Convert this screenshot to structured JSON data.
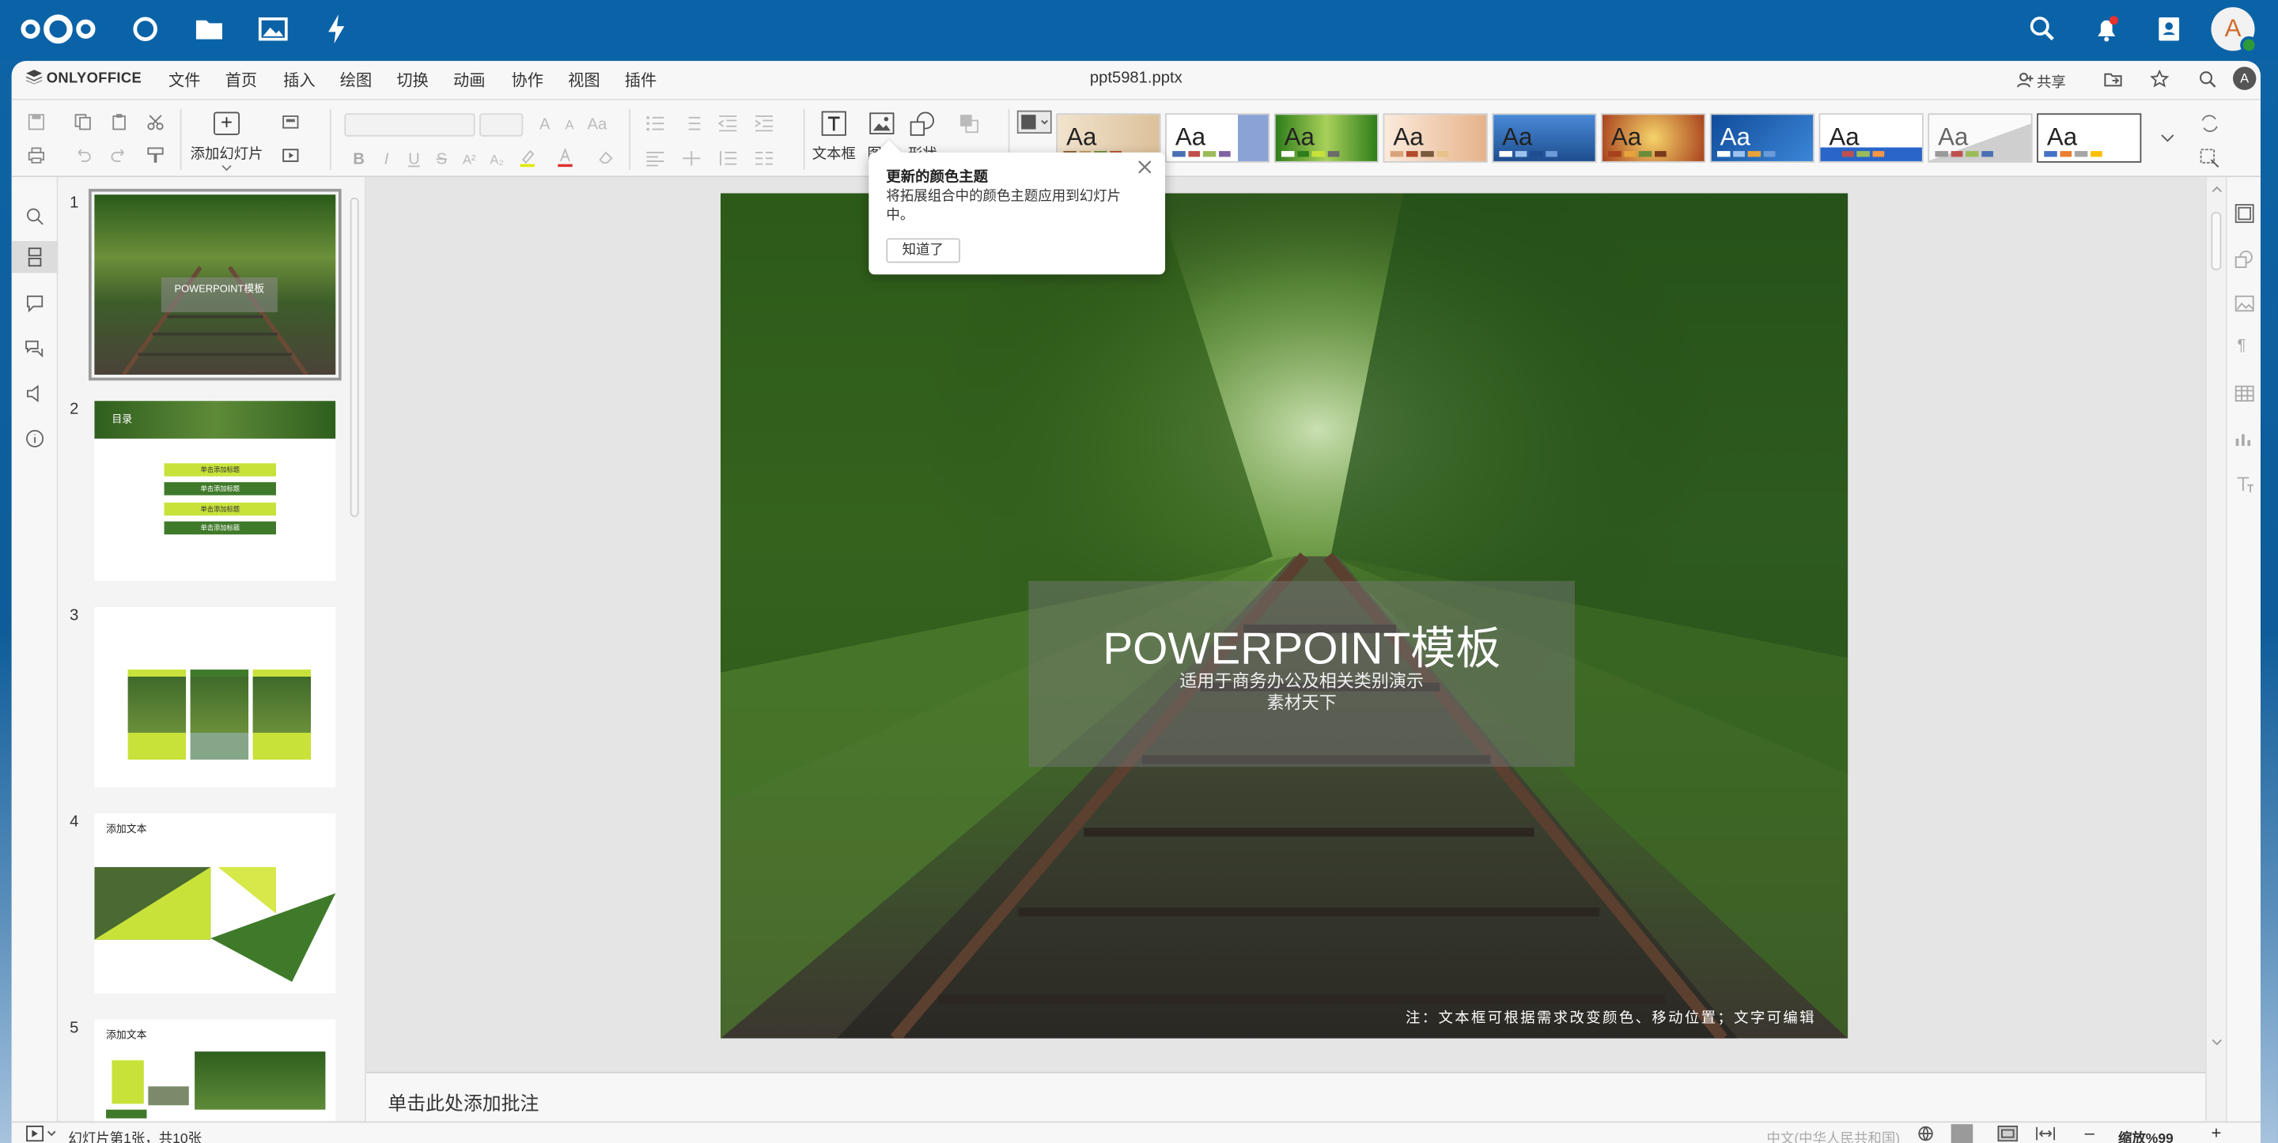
{
  "nextcloud": {
    "apps": [
      "dashboard-icon",
      "files-icon",
      "photos-icon",
      "activity-icon"
    ],
    "avatar_letter": "A"
  },
  "editor": {
    "brand": "ONLYOFFICE",
    "menu": [
      "文件",
      "首页",
      "插入",
      "绘图",
      "切换",
      "动画",
      "协作",
      "视图",
      "插件"
    ],
    "active_menu": "首页",
    "doc_title": "ppt5981.pptx",
    "share_label": "共享",
    "user_letter": "A"
  },
  "toolbar": {
    "add_slide": "添加幻灯片",
    "textbox": "文本框",
    "picture": "图片",
    "shape": "形状",
    "themes": [
      {
        "label": "Aa",
        "bg": "#e8d7bd",
        "accent": "#8a5a2b"
      },
      {
        "label": "Aa",
        "bg": "#dfe6f3",
        "accent": "#8aa2d6"
      },
      {
        "label": "Aa",
        "bg": "#9bc84a",
        "accent": "#2f7d1a"
      },
      {
        "label": "Aa",
        "bg": "#f6e2cf",
        "accent": "#d9a37a"
      },
      {
        "label": "Aa",
        "bg": "#3a77c6",
        "accent": "#1e4e8f"
      },
      {
        "label": "Aa",
        "bg": "#e8a23a",
        "accent": "#a8421d"
      },
      {
        "label": "Aa",
        "bg": "#2e6fc2",
        "accent": "#0f4c99"
      },
      {
        "label": "Aa",
        "bg": "#ffffff",
        "accent": "#2a66c9"
      },
      {
        "label": "Aa",
        "bg": "#eeeeee",
        "accent": "#9a9a9a"
      },
      {
        "label": "Aa",
        "bg": "#ffffff",
        "accent": "#cccccc"
      }
    ]
  },
  "popover": {
    "title": "更新的颜色主题",
    "body": "将拓展组合中的颜色主题应用到幻灯片中。",
    "button": "知道了"
  },
  "thumbnails": [
    {
      "num": "1",
      "title": "POWERPOINT模板"
    },
    {
      "num": "2",
      "title": "目录",
      "items": [
        "单击添加标题",
        "单击添加标题",
        "单击添加标题",
        "单击添加标题"
      ]
    },
    {
      "num": "3"
    },
    {
      "num": "4",
      "title": "添加文本"
    },
    {
      "num": "5",
      "title": "添加文本"
    }
  ],
  "slide": {
    "title": "POWERPOINT模板",
    "subtitle": "适用于商务办公及相关类别演示",
    "subtitle2": "素材天下",
    "note": "注：文本框可根据需求改变颜色、移动位置；文字可编辑"
  },
  "notes_placeholder": "单击此处添加批注",
  "status": {
    "slide_info": "幻灯片第1张，共10张",
    "language": "中文(中华人民共和国)",
    "zoom": "缩放%99"
  },
  "colors": {
    "nextcloud_blue": "#0b63a7",
    "slide_green": "#3f7a2a",
    "accent_lime": "#c8e23a"
  }
}
